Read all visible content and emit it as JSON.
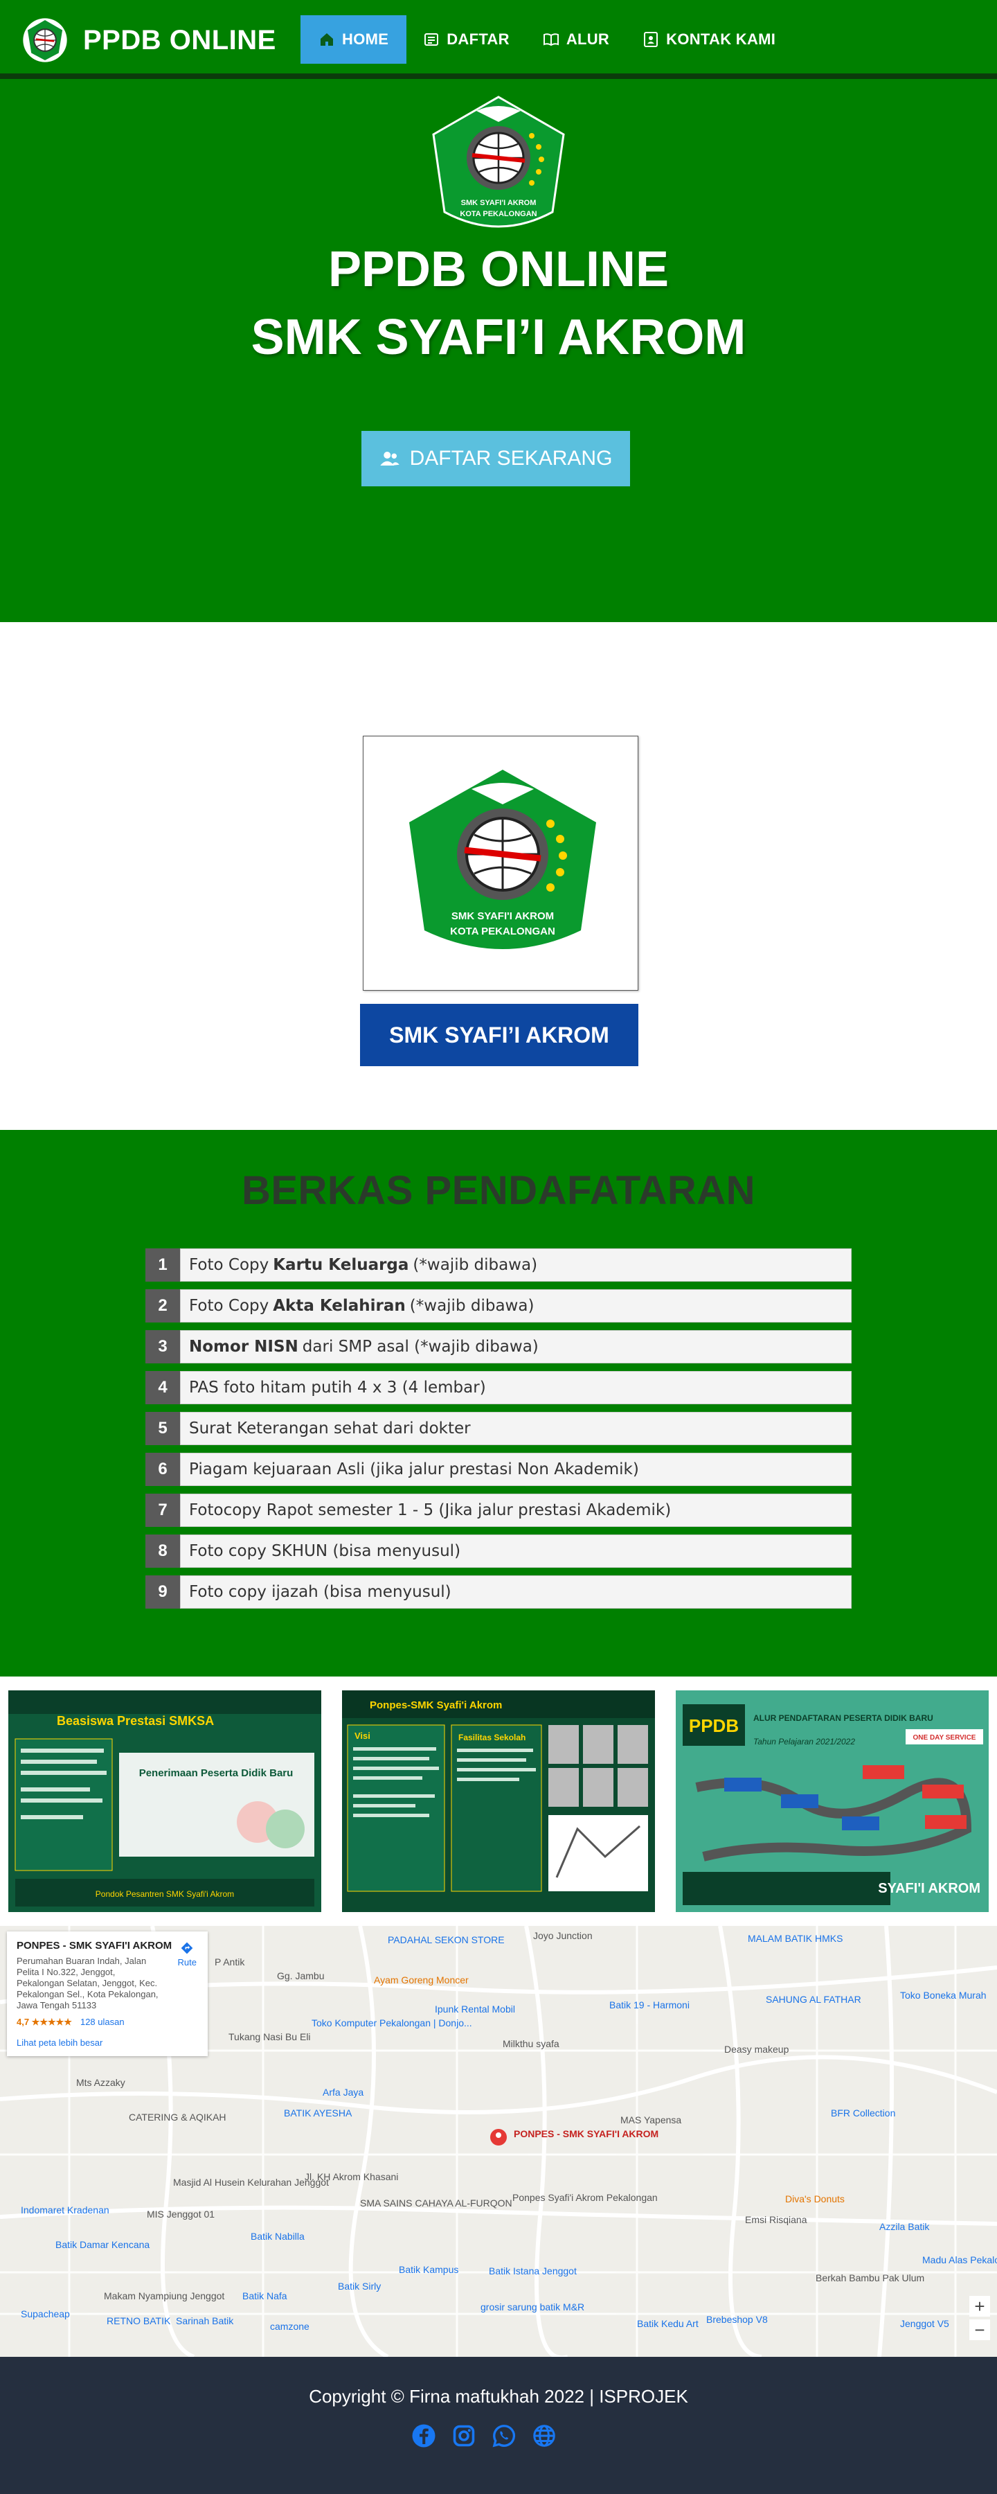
{
  "nav": {
    "brand": "PPDB ONLINE",
    "items": [
      {
        "label": "HOME",
        "icon": "home-icon",
        "active": true
      },
      {
        "label": "DAFTAR",
        "icon": "list-icon"
      },
      {
        "label": "ALUR",
        "icon": "book-icon"
      },
      {
        "label": "KONTAK KAMI",
        "icon": "contact-icon"
      }
    ]
  },
  "hero": {
    "logo_caption_1": "SMK SYAFI'I AKROM",
    "logo_caption_2": "KOTA PEKALONGAN",
    "title_line1": "PPDB ONLINE",
    "title_line2": "SMK SYAFI’I AKROM",
    "cta": "DAFTAR SEKARANG"
  },
  "profile": {
    "name": "SMK SYAFI’I AKROM"
  },
  "berkas": {
    "title": "BERKAS PENDAFATARAN",
    "items": [
      {
        "num": "1",
        "pre": "Foto Copy",
        "bold": "Kartu Keluarga",
        "post": "(*wajib dibawa)"
      },
      {
        "num": "2",
        "pre": "Foto Copy",
        "bold": "Akta Kelahiran",
        "post": "(*wajib dibawa)"
      },
      {
        "num": "3",
        "pre": "",
        "bold": "Nomor NISN",
        "post": "dari SMP asal (*wajib dibawa)"
      },
      {
        "num": "4",
        "pre": "PAS foto hitam putih 4 x 3 (4 lembar)",
        "bold": "",
        "post": ""
      },
      {
        "num": "5",
        "pre": "Surat Keterangan sehat dari dokter",
        "bold": "",
        "post": ""
      },
      {
        "num": "6",
        "pre": "Piagam kejuaraan Asli (jika jalur prestasi Non Akademik)",
        "bold": "",
        "post": ""
      },
      {
        "num": "7",
        "pre": "Fotocopy Rapot semester 1 - 5 (Jika jalur prestasi Akademik)",
        "bold": "",
        "post": ""
      },
      {
        "num": "8",
        "pre": "Foto copy SKHUN (bisa menyusul)",
        "bold": "",
        "post": ""
      },
      {
        "num": "9",
        "pre": "Foto copy ijazah (bisa menyusul)",
        "bold": "",
        "post": ""
      }
    ]
  },
  "banners": {
    "b1_title": "Beasiswa Prestasi SMKSA",
    "b1_sub": "Penerimaan Peserta Didik Baru",
    "b1_school": "Pondok Pesantren SMK Syafi'i Akrom",
    "b2_title": "Ponpes-SMK Syafi'i Akrom",
    "b2_sub": "Visi",
    "b2_sub2": "Fasilitas Sekolah",
    "b3_title": "PPDB",
    "b3_sub": "ALUR PENDAFTARAN PESERTA DIDIK BARU",
    "b3_year": "Tahun Pelajaran 2021/2022",
    "b3_tag": "ONE DAY SERVICE",
    "b3_school": "SYAFI'I AKROM"
  },
  "map": {
    "card_title": "PONPES - SMK SYAFI'I AKROM",
    "card_address": "Perumahan Buaran Indah, Jalan Pelita I No.322, Jenggot, Pekalongan Selatan, Jenggot, Kec. Pekalongan Sel., Kota Pekalongan, Jawa Tengah 51133",
    "rating": "4,7 ★★★★★",
    "reviews": "128 ulasan",
    "link": "Lihat peta lebih besar",
    "route": "Rute",
    "marker_label": "PONPES - SMK SYAFI'I AKROM",
    "labels": [
      "PADAHAL SEKON STORE",
      "Joyo Junction",
      "MALAM BATIK HMKS",
      "P Antik",
      "Gg. Jambu",
      "Ayam Goreng Moncer",
      "Toko Komputer Pekalongan | Donjo...",
      "Ipunk Rental Mobil",
      "Batik 19 - Harmoni",
      "SAHUNG AL FATHAR",
      "Toko Boneka Murah",
      "Tukang Nasi Bu Eli",
      "Milkthu syafa",
      "Deasy makeup",
      "Mts Azzaky",
      "Arfa Jaya",
      "BATIK AYESHA",
      "CATERING & AQIKAH",
      "MAS Yapensa",
      "BFR Collection",
      "Jl. KH Akrom Khasani",
      "SMA SAINS CAHAYA AL-FURQON",
      "Ponpes Syafi'i Akrom Pekalongan",
      "Masjid Al Husein Kelurahan Jenggot",
      "MIS Jenggot 01",
      "Indomaret Kradenan",
      "Batik Damar Kencana",
      "Batik Nabilla",
      "Diva's Donuts",
      "Emsi Risqiana",
      "Azzila Batik",
      "Madu Alas Pekalongan",
      "Batik Kampus",
      "Batik Istana Jenggot",
      "Makam Nyampiung Jenggot",
      "Batik Nafa",
      "Batik Sirly",
      "grosir sarung batik M&R",
      "Berkah Bambu Pak Ulum",
      "Supacheap",
      "RETNO BATIK",
      "Sarinah Batik",
      "camzone",
      "Batik Kedu Art",
      "Brebeshop V8",
      "Jenggot V5"
    ]
  },
  "footer": {
    "copyright": "Copyright © Firna maftukhah 2022 | ISPROJEK",
    "socials": [
      "facebook-icon",
      "instagram-icon",
      "whatsapp-icon",
      "globe-icon"
    ]
  },
  "colors": {
    "primary_green": "#008000",
    "active_tab": "#37a2e0",
    "cta": "#5bc0de",
    "profile_button": "#0d47a1",
    "footer": "#252f3f"
  }
}
